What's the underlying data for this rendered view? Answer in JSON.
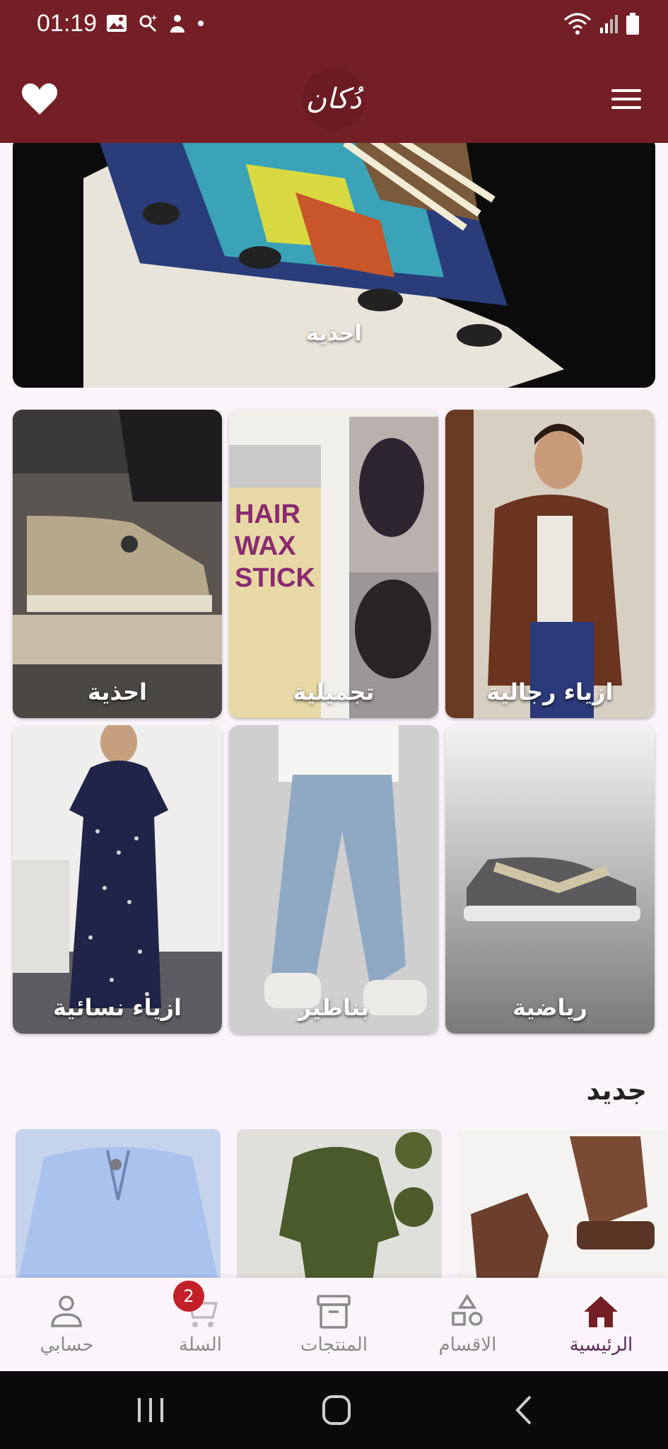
{
  "status_bar": {
    "time": "01:19"
  },
  "app": {
    "logo_text": "دُكان"
  },
  "hero": {
    "label": "احذية"
  },
  "categories": [
    {
      "label": "ازياء رجالية"
    },
    {
      "label": "تجميلية"
    },
    {
      "label": "احذية"
    },
    {
      "label": "رياضية"
    },
    {
      "label": "بناطير"
    },
    {
      "label": "ازياء نسائية"
    }
  ],
  "new_section": {
    "title": "جديد"
  },
  "bottom_nav": {
    "items": [
      {
        "label": "الرئيسية",
        "icon": "home-icon",
        "active": true
      },
      {
        "label": "الاقسام",
        "icon": "shapes-icon"
      },
      {
        "label": "المنتجات",
        "icon": "archive-icon"
      },
      {
        "label": "السلة",
        "icon": "cart-icon",
        "badge": "2"
      },
      {
        "label": "حسابي",
        "icon": "person-icon"
      }
    ]
  },
  "colors": {
    "brand": "#741f25",
    "active_nav": "#741f25",
    "badge": "#c4202a"
  }
}
